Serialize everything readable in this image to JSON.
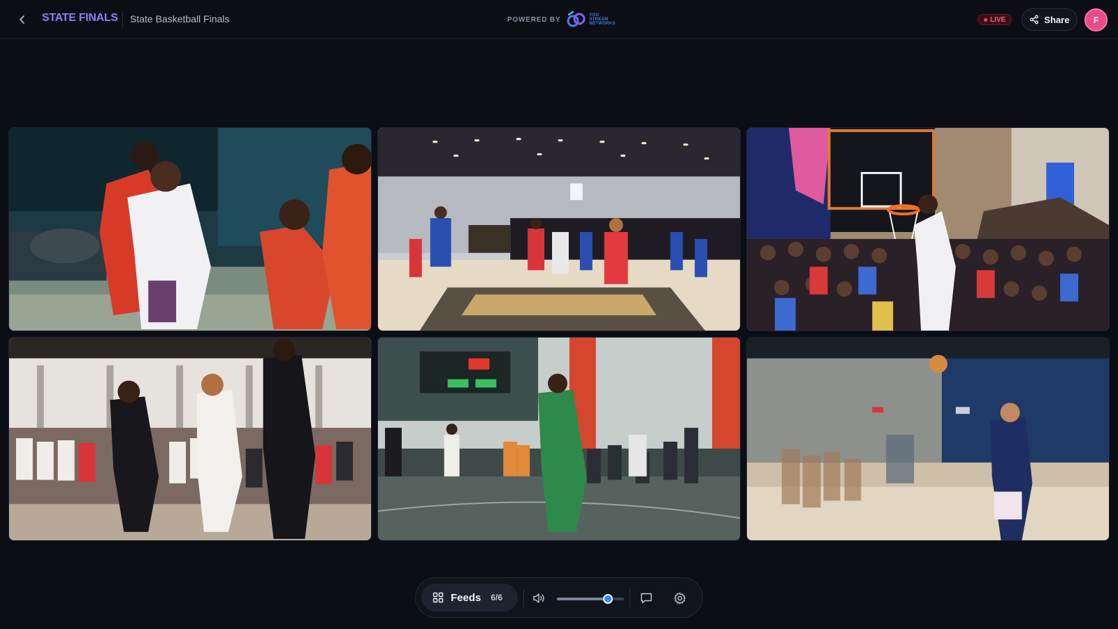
{
  "header": {
    "back_icon": "chevron-left-icon",
    "brand": "STATE FINALS",
    "event_title": "State Basketball Finals",
    "powered_by": "POWERED BY",
    "network_logo_lines": [
      "YOU",
      "STREAM",
      "NETWORKS"
    ],
    "live_label": "LIVE",
    "share_label": "Share",
    "share_icon": "share-icon",
    "avatar_initial": "F",
    "colors": {
      "brand": "#8f7cf7",
      "live": "#ff4257",
      "avatar": "#ec4a86"
    }
  },
  "feeds": [
    {
      "name": "feed-1",
      "scene": "close-up of players in red and white jerseys"
    },
    {
      "name": "feed-2",
      "scene": "convention-hall court with tip-off"
    },
    {
      "name": "feed-3",
      "scene": "dunk at basket with crowd"
    },
    {
      "name": "feed-4",
      "scene": "players in black and white jerseys on indoor court"
    },
    {
      "name": "feed-5",
      "scene": "gym with green jersey player and scoreboard"
    },
    {
      "name": "feed-6",
      "scene": "blurry blue gym with ball in air"
    }
  ],
  "controls": {
    "feeds_label": "Feeds",
    "feeds_count": "6/6",
    "volume_level": 0.76,
    "icons": [
      "grid-icon",
      "volume-icon",
      "chat-icon",
      "settings-icon"
    ],
    "accent": "#2f8cff"
  }
}
